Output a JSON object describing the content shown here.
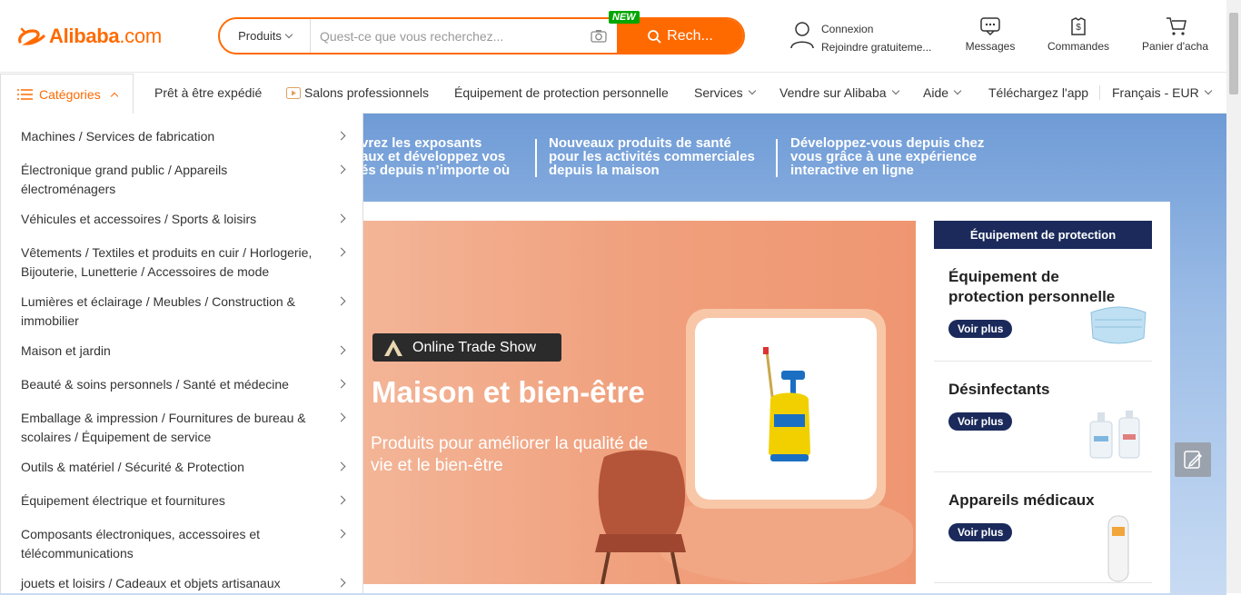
{
  "header": {
    "logo_text": "Alibaba",
    "logo_suffix": ".com",
    "search": {
      "category": "Produits",
      "placeholder": "Quest-ce que vous recherchez...",
      "button_label": "Rech...",
      "new_badge": "NEW"
    },
    "account": {
      "login": "Connexion",
      "join": "Rejoindre gratuiteme..."
    },
    "messages_label": "Messages",
    "orders_label": "Commandes",
    "cart_label": "Panier d'acha"
  },
  "nav": {
    "categories_label": "Catégories",
    "items": [
      "Prêt à être expédié",
      "Salons professionnels",
      "Équipement de protection personnelle",
      "Services",
      "Vendre sur Alibaba",
      "Aide",
      "Téléchargez l'app",
      "Français - EUR"
    ]
  },
  "sidebar": {
    "items": [
      "Machines / Services de fabrication",
      "Électronique grand public / Appareils électroménagers",
      "Véhicules et accessoires / Sports & loisirs",
      "Vêtements / Textiles et produits en cuir / Horlogerie, Bijouterie, Lunetterie / Accessoires de mode",
      "Lumières et éclairage / Meubles / Construction & immobilier",
      "Maison et jardin",
      "Beauté & soins personnels / Santé et médecine",
      "Emballage & impression / Fournitures de bureau & scolaires / Équipement de service",
      "Outils & matériel / Sécurité & Protection",
      "Équipement électrique et fournitures",
      "Composants électroniques, accessoires et télécommunications",
      "jouets et loisirs / Cadeaux et objets artisanaux"
    ]
  },
  "band": {
    "item1": "...vrez les exposants ...aux et développez vos ...és depuis n'importe où",
    "item1_l1": "vrez les exposants",
    "item1_l2": "aux et développez vos",
    "item1_l3": "és depuis n’importe où",
    "item2_l1": "Nouveaux produits de santé",
    "item2_l2": "pour les activités commerciales",
    "item2_l3": "depuis la maison",
    "item3_l1": "Développez-vous depuis chez",
    "item3_l2": "vous grâce à une expérience",
    "item3_l3": "interactive en ligne"
  },
  "banner": {
    "badge": "Online Trade Show",
    "title": "Maison et bien-être",
    "subtitle": "Produits pour améliorer la qualité de vie et le bien-être"
  },
  "right": {
    "header": "Équipement de protection",
    "cards": [
      {
        "title": "Équipement de protection personnelle",
        "button": "Voir plus"
      },
      {
        "title": "Désinfectants",
        "button": "Voir plus"
      },
      {
        "title": "Appareils médicaux",
        "button": "Voir plus"
      }
    ]
  },
  "colors": {
    "accent": "#ff6a00",
    "navy": "#1b2a5b",
    "new_badge": "#00a600"
  }
}
